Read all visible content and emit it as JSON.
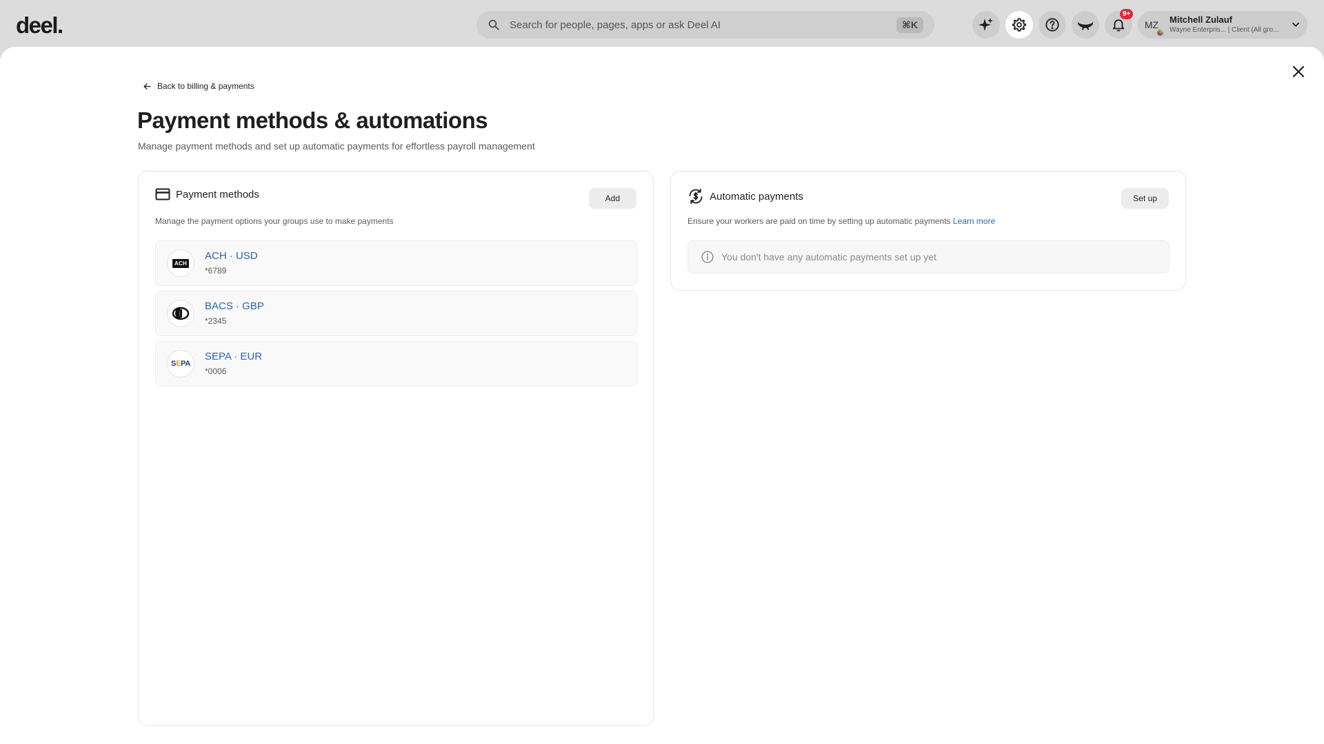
{
  "header": {
    "logo": "deel.",
    "search": {
      "placeholder": "Search for people, pages, apps or ask Deel AI",
      "shortcut": "⌘K"
    },
    "notifications_badge": "9+",
    "user": {
      "initials": "MZ",
      "name": "Mitchell Zulauf",
      "subtitle": "Wayne Enterpris... | Client (All gro..."
    }
  },
  "page": {
    "back_label": "Back to billing & payments",
    "title": "Payment methods & automations",
    "subtitle": "Manage payment methods and set up automatic payments for effortless payroll management"
  },
  "payment_methods": {
    "title": "Payment methods",
    "add_label": "Add",
    "description": "Manage the payment options your groups use to make payments",
    "items": [
      {
        "name": "ACH · USD",
        "number": "*6789",
        "logo": "ACH"
      },
      {
        "name": "BACS · GBP",
        "number": "*2345",
        "logo": "bacs-logo"
      },
      {
        "name": "SEPA · EUR",
        "number": "*0006",
        "logo": "SEPA"
      }
    ]
  },
  "automatic_payments": {
    "title": "Automatic payments",
    "setup_label": "Set up",
    "description": "Ensure your workers are paid on time by setting up automatic payments",
    "learn_more": "Learn more",
    "empty_text": "You don't have any automatic payments set up yet"
  },
  "colors": {
    "link": "#2b63b4",
    "badge": "#e5243b",
    "topbar_bg": "#dcdcdc"
  }
}
